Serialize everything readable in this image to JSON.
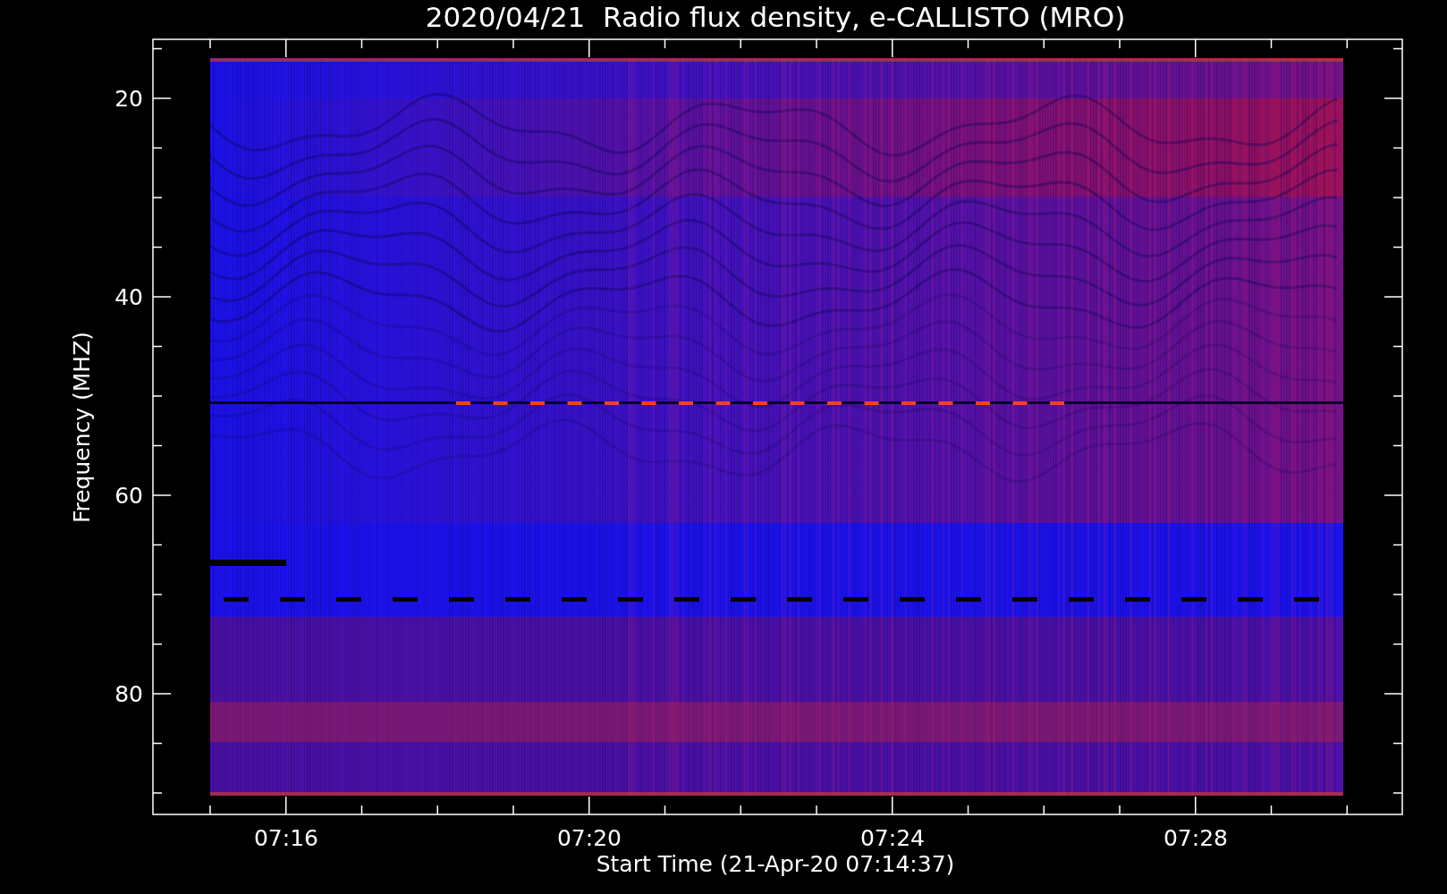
{
  "title": "2020/04/21  Radio flux density, e-CALLISTO (MRO)",
  "y_axis": {
    "label": "Frequency (MHZ)",
    "ticks": [
      "20",
      "40",
      "60",
      "80"
    ]
  },
  "x_axis": {
    "label": "Start Time (21-Apr-20 07:14:37)",
    "ticks": [
      "07:16",
      "07:20",
      "07:24",
      "07:28"
    ]
  }
}
